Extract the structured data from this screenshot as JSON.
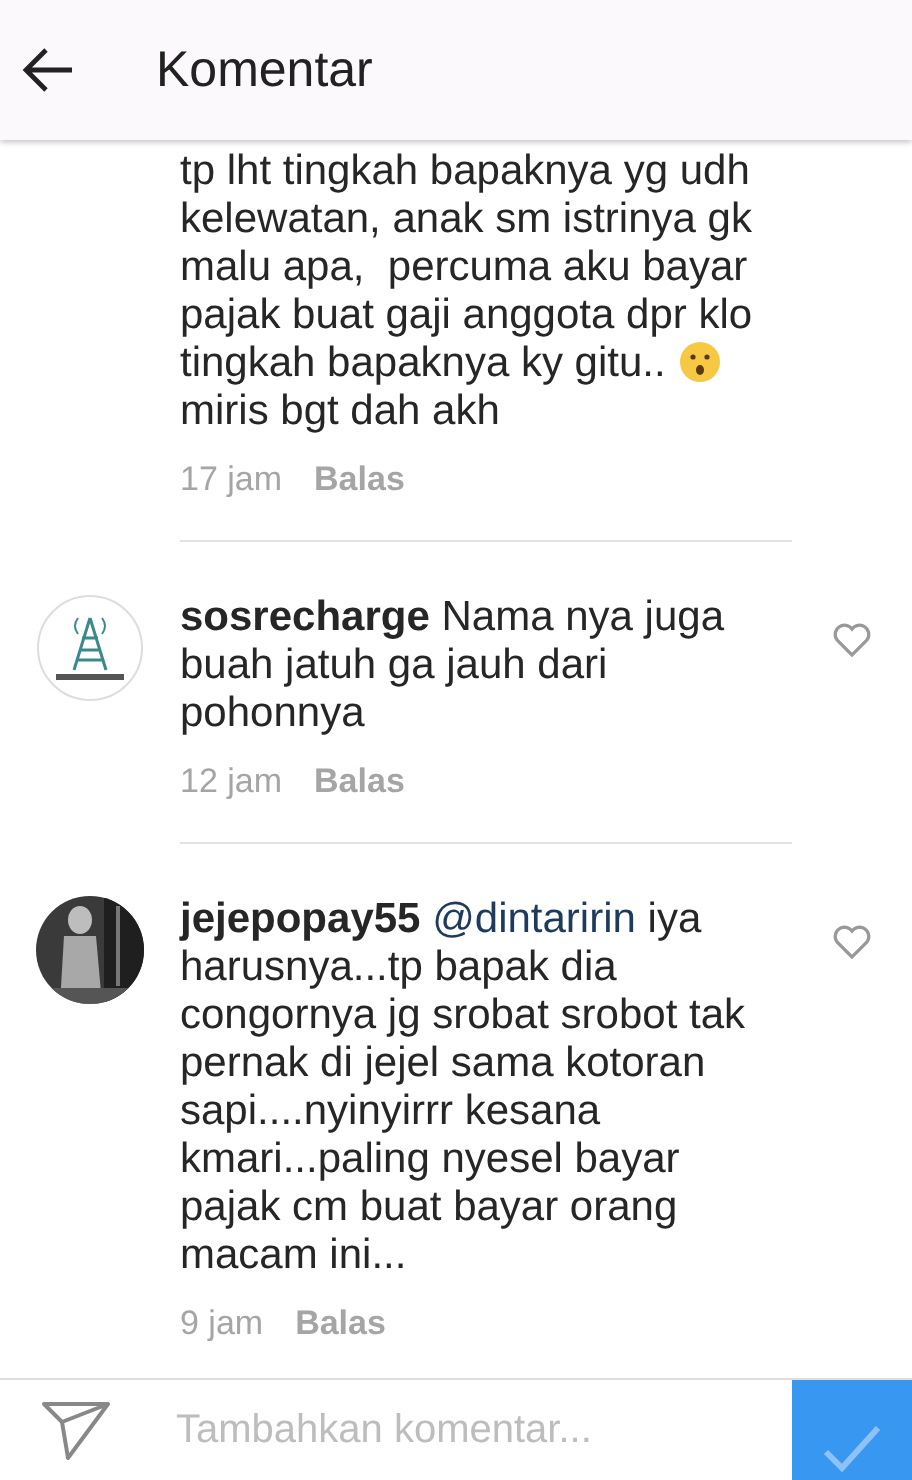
{
  "header": {
    "title": "Komentar"
  },
  "comments": [
    {
      "heart": false,
      "lines": [
        {
          "kind": "plain",
          "text": "tp lht tingkah bapaknya yg udh"
        },
        {
          "kind": "plain",
          "text": "kelewatan, anak sm istrinya gk"
        },
        {
          "kind": "plain",
          "text": "malu apa,  percuma aku bayar"
        },
        {
          "kind": "plain",
          "text": "pajak buat gaji anggota dpr klo"
        },
        {
          "kind": "emoji_end",
          "text": "tingkah bapaknya ky gitu.."
        },
        {
          "kind": "plain",
          "text": "miris bgt dah akh"
        }
      ],
      "time": "17 jam",
      "reply": "Balas"
    },
    {
      "username": "sosrecharge",
      "heart": true,
      "lines": [
        {
          "kind": "plain",
          "text": "Nama nya juga"
        },
        {
          "kind": "plain",
          "text": "buah jatuh ga jauh dari"
        },
        {
          "kind": "plain",
          "text": "pohonnya"
        }
      ],
      "time": "12 jam",
      "reply": "Balas"
    },
    {
      "username": "jejepopay55",
      "mention": "@dintaririn",
      "heart": true,
      "lines": [
        {
          "kind": "plain",
          "text": "iya"
        },
        {
          "kind": "plain",
          "text": "harusnya...tp bapak dia"
        },
        {
          "kind": "plain",
          "text": "congornya jg srobat srobot tak"
        },
        {
          "kind": "plain",
          "text": "pernak di jejel sama kotoran"
        },
        {
          "kind": "plain",
          "text": "sapi....nyinyirrr kesana"
        },
        {
          "kind": "plain",
          "text": "kmari...paling nyesel bayar"
        },
        {
          "kind": "plain",
          "text": "pajak cm buat bayar orang"
        },
        {
          "kind": "plain",
          "text": "macam ini..."
        }
      ],
      "time": "9 jam",
      "reply": "Balas"
    }
  ],
  "composer": {
    "placeholder": "Tambahkan komentar..."
  }
}
